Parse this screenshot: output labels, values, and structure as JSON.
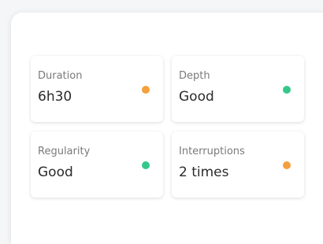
{
  "metrics": [
    {
      "label": "Duration",
      "value": "6h30",
      "status_color": "#f4a03c"
    },
    {
      "label": "Depth",
      "value": "Good",
      "status_color": "#34c78a"
    },
    {
      "label": "Regularity",
      "value": "Good",
      "status_color": "#34c78a"
    },
    {
      "label": "Interruptions",
      "value": "2 times",
      "status_color": "#f4a03c"
    }
  ]
}
